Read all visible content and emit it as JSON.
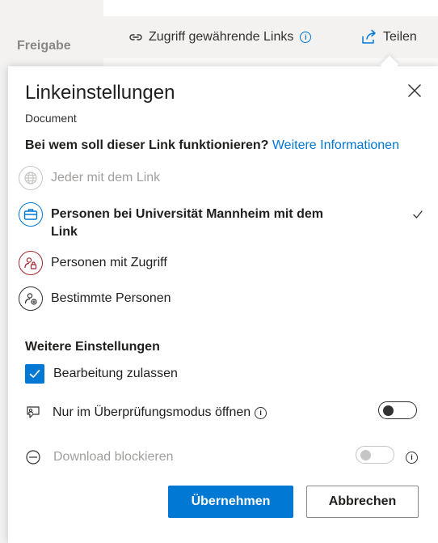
{
  "background": {
    "sidebar_label": "Freigabe",
    "toolbar": {
      "links_label": "Zugriff gewährende Links",
      "links_info": "i",
      "share_label": "Teilen"
    }
  },
  "panel": {
    "title": "Linkeinstellungen",
    "subtitle": "Document",
    "question": "Bei wem soll dieser Link funktionieren?",
    "more_info_link": "Weitere Informationen",
    "options": [
      {
        "label": "Jeder mit dem Link",
        "icon": "globe-icon",
        "state": "disabled"
      },
      {
        "label": "Personen bei Universität Mannheim mit dem Link",
        "icon": "briefcase-icon",
        "state": "selected"
      },
      {
        "label": "Personen mit Zugriff",
        "icon": "people-lock-icon",
        "state": "available"
      },
      {
        "label": "Bestimmte Personen",
        "icon": "people-add-icon",
        "state": "available"
      }
    ],
    "more_settings_title": "Weitere Einstellungen",
    "settings": {
      "allow_edit": {
        "label": "Bearbeitung zulassen",
        "checked": true
      },
      "review_mode": {
        "label": "Nur im Überprüfungsmodus öffnen",
        "info": "i",
        "enabled": false
      },
      "block_download": {
        "label": "Download blockieren",
        "info": "i",
        "enabled": false,
        "disabled": true
      }
    },
    "buttons": {
      "apply": "Übernehmen",
      "cancel": "Abbrechen"
    }
  },
  "colors": {
    "accent": "#0078d4",
    "restricted": "#a4262c",
    "disabled": "#a19f9d"
  }
}
